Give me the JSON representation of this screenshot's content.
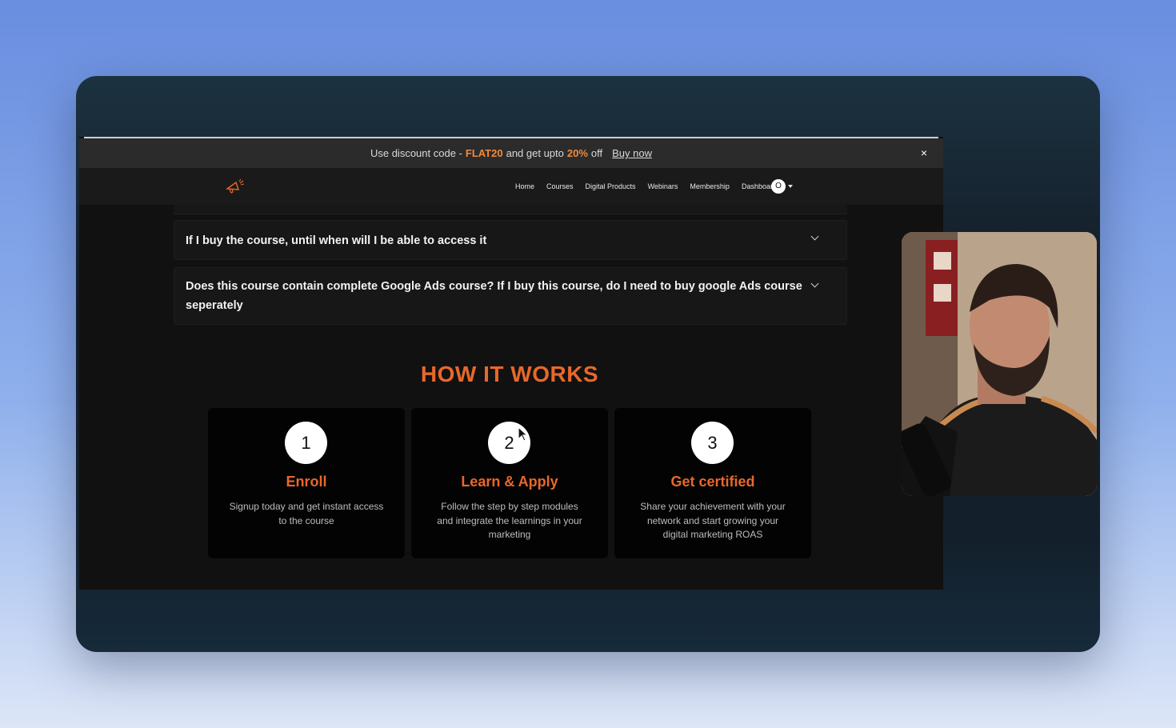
{
  "promo": {
    "prefix": "Use discount code -",
    "code": "FLAT20",
    "middle": "and get upto",
    "percent": "20%",
    "suffix": "off",
    "cta": "Buy now",
    "close": "×"
  },
  "nav": {
    "logo_icon": "megaphone-icon",
    "items": [
      "Home",
      "Courses",
      "Digital Products",
      "Webinars",
      "Membership",
      "Dashboard"
    ],
    "avatar_letter": "O"
  },
  "faq": [
    {
      "question": "If I buy the course, until when will I be able to access it"
    },
    {
      "question": "Does this course contain complete Google Ads course? If I buy this course, do I need to buy google Ads course seperately"
    }
  ],
  "how_it_works": {
    "title": "HOW IT WORKS",
    "steps": [
      {
        "number": "1",
        "title": "Enroll",
        "description": "Signup today and get instant access to the course"
      },
      {
        "number": "2",
        "title": "Learn & Apply",
        "description": "Follow the step by step modules and integrate the learnings in your marketing"
      },
      {
        "number": "3",
        "title": "Get certified",
        "description": "Share your achievement with your network and start growing your digital marketing ROAS"
      }
    ]
  },
  "colors": {
    "accent": "#e8682a",
    "page_bg": "#111111",
    "promo_bg": "#2b2b2b"
  }
}
